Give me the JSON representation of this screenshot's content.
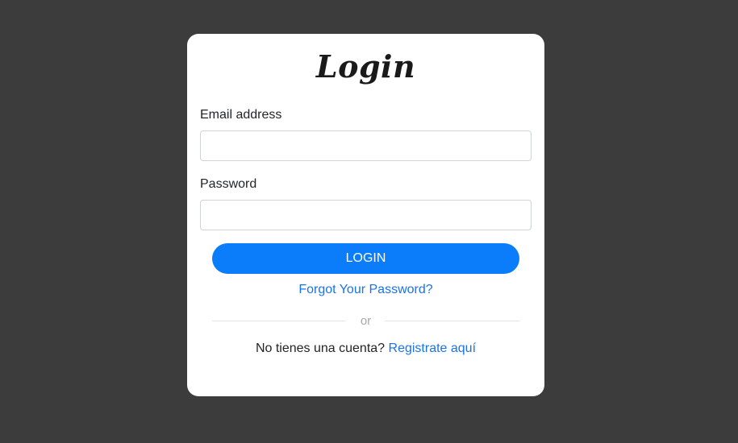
{
  "login": {
    "title": "Login",
    "email": {
      "label": "Email address",
      "value": "",
      "placeholder": ""
    },
    "password": {
      "label": "Password",
      "value": "",
      "placeholder": ""
    },
    "submit_label": "LOGIN",
    "forgot_link": "Forgot Your Password?",
    "divider_text": "or",
    "register_prompt": "No tienes una cuenta?",
    "register_link": "Registrate aquí"
  },
  "colors": {
    "background": "#3c3c3c",
    "card": "#ffffff",
    "primary_button": "#0b7dfb",
    "link": "#1a73e8",
    "input_border": "#ced4da",
    "divider": "#e3e3e3"
  }
}
